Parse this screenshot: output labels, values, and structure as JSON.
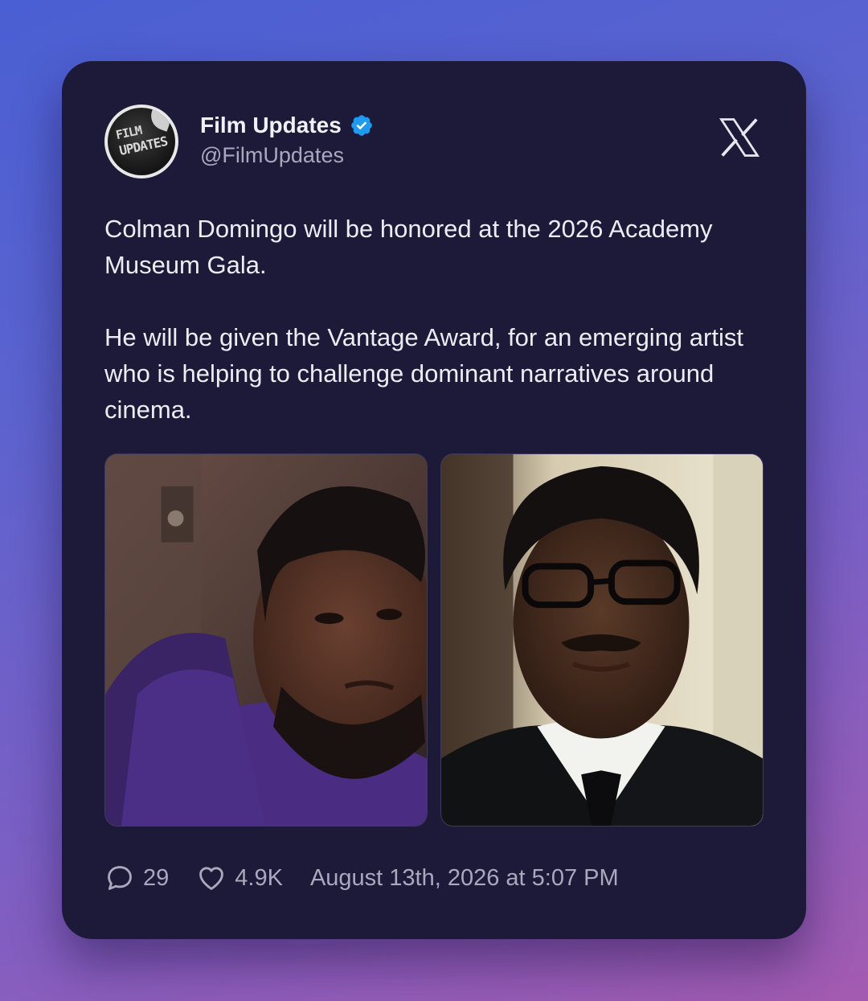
{
  "account": {
    "display_name": "Film Updates",
    "handle": "@FilmUpdates",
    "avatar_text_line1": "FILM",
    "avatar_text_line2": "UPDATES",
    "verified": true,
    "verified_color": "#1d9bf0"
  },
  "platform_icon": "x-logo-icon",
  "tweet": {
    "paragraphs": [
      "Colman Domingo will be honored at the 2026 Academy Museum Gala.",
      "He will be given the Vantage Award, for an emerging artist who is helping to challenge dominant narratives around cinema."
    ]
  },
  "media": [
    {
      "name": "photo-purple-hoodie"
    },
    {
      "name": "photo-suit-glasses"
    }
  ],
  "footer": {
    "replies": "29",
    "likes": "4.9K",
    "timestamp": "August 13th, 2026 at 5:07 PM",
    "reply_icon": "comment-icon",
    "like_icon": "heart-icon"
  },
  "colors": {
    "card_background": "#1c1a38",
    "text_primary": "#ececf2",
    "text_secondary": "#a9a8bd"
  }
}
